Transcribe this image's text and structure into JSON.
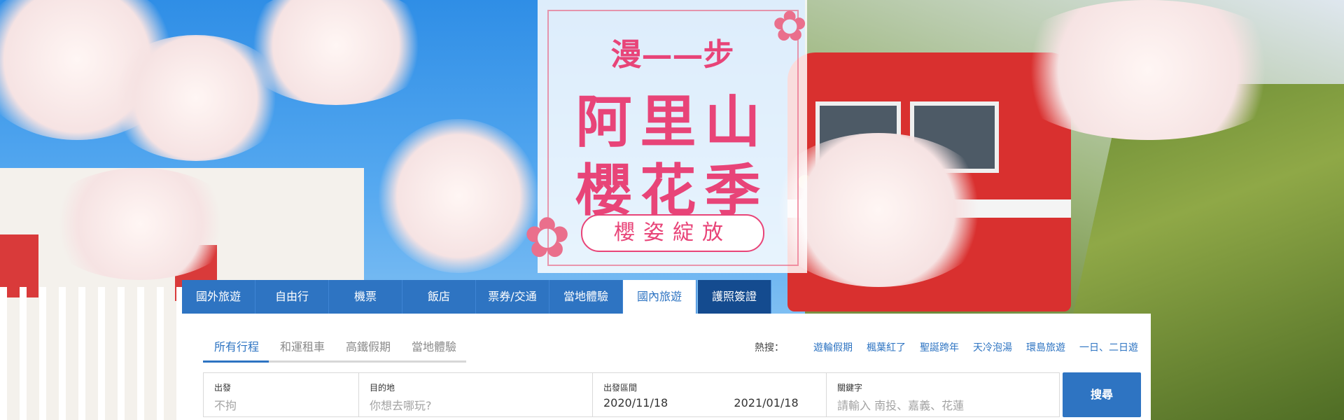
{
  "promo": {
    "line1": "漫——步",
    "line2": "阿里山",
    "line3": "櫻花季",
    "tagline": "櫻姿綻放"
  },
  "tabs": [
    "國外旅遊",
    "自由行",
    "機票",
    "飯店",
    "票券/交通",
    "當地體驗",
    "國內旅遊",
    "護照簽證"
  ],
  "active_tab": "國內旅遊",
  "subtabs": [
    "所有行程",
    "和運租車",
    "高鐵假期",
    "當地體驗"
  ],
  "active_subtab": "所有行程",
  "hot_search": {
    "label": "熱搜：",
    "items": [
      "遊輪假期",
      "楓葉紅了",
      "聖誕跨年",
      "天冷泡湯",
      "環島旅遊",
      "一日、二日遊"
    ]
  },
  "form": {
    "depart": {
      "label": "出發",
      "value": "不拘"
    },
    "destination": {
      "label": "目的地",
      "placeholder": "你想去哪玩?"
    },
    "date_range": {
      "label": "出發區間",
      "start": "2020/11/18",
      "end": "2021/01/18"
    },
    "keyword": {
      "label": "關鍵字",
      "placeholder": "請輸入 南投、嘉義、花蓮"
    },
    "search_label": "搜尋"
  },
  "colors": {
    "brand_blue": "#2e74c2",
    "visa_tab": "#144b8f",
    "promo_pink": "#e84478"
  }
}
